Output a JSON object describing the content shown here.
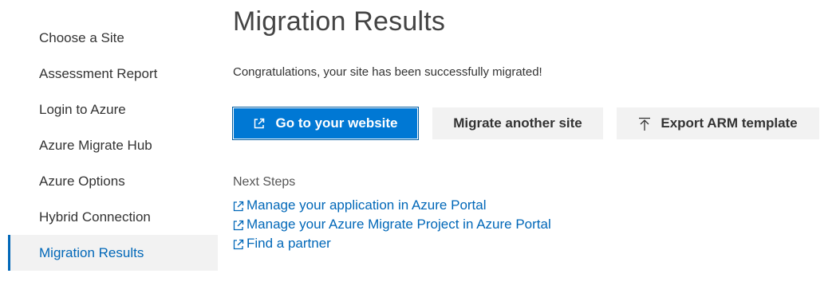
{
  "sidebar": {
    "items": [
      {
        "label": "Choose a Site"
      },
      {
        "label": "Assessment Report"
      },
      {
        "label": "Login to Azure"
      },
      {
        "label": "Azure Migrate Hub"
      },
      {
        "label": "Azure Options"
      },
      {
        "label": "Hybrid Connection"
      },
      {
        "label": "Migration Results",
        "active": true
      }
    ]
  },
  "main": {
    "title": "Migration Results",
    "message": "Congratulations, your site has been successfully migrated!",
    "buttons": {
      "go_to_website": "Go to your website",
      "migrate_another": "Migrate another site",
      "export_arm": "Export ARM template"
    },
    "next_steps": {
      "heading": "Next Steps",
      "links": [
        {
          "label": "Manage your application in Azure Portal",
          "icon": "external-link-icon"
        },
        {
          "label": "Manage your Azure Migrate Project in Azure Portal",
          "icon": "external-link-icon"
        },
        {
          "label": "Find a partner",
          "icon": "external-link-icon"
        }
      ]
    }
  },
  "colors": {
    "accent": "#0067b8",
    "primary_button": "#0078d4",
    "secondary_button": "#f2f2f2",
    "active_nav_bg": "#f2f2f2"
  }
}
